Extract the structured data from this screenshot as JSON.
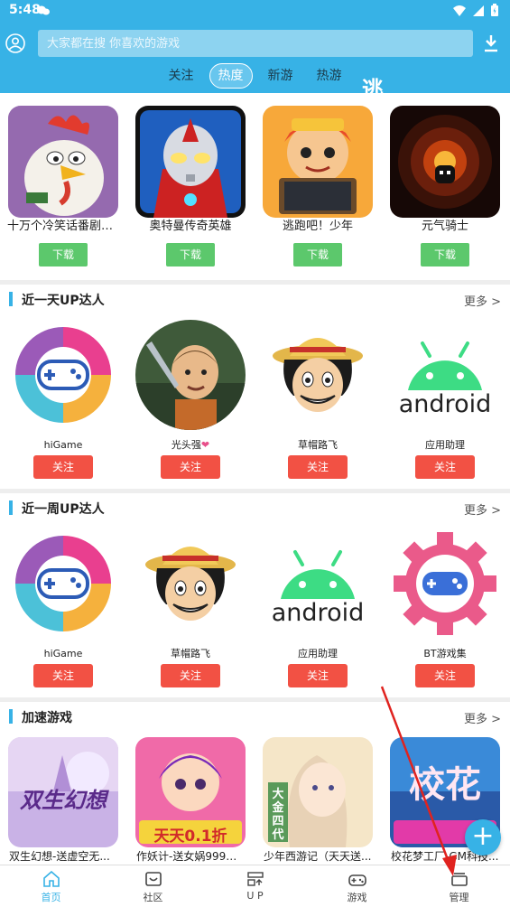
{
  "status_bar": {
    "time": "5:48"
  },
  "search": {
    "placeholder": "大家都在搜 你喜欢的游戏"
  },
  "tabs": [
    {
      "label": "关注"
    },
    {
      "label": "热度"
    },
    {
      "label": "新游"
    },
    {
      "label": "热游"
    }
  ],
  "featured_games": [
    {
      "name": "十万个冷笑话番剧版...",
      "button": "下载"
    },
    {
      "name": "奥特曼传奇英雄",
      "button": "下载"
    },
    {
      "name": "逃跑吧！少年",
      "button": "下载",
      "sign_text": "逃"
    },
    {
      "name": "元气骑士",
      "button": "下载"
    }
  ],
  "section_day": {
    "title": "近一天UP达人",
    "more": "更多 >",
    "users": [
      {
        "name": "hiGame",
        "button": "关注"
      },
      {
        "name": "光头强",
        "button": "关注"
      },
      {
        "name": "草帽路飞",
        "button": "关注"
      },
      {
        "name": "应用助理",
        "button": "关注",
        "logo_text": "android"
      }
    ]
  },
  "section_week": {
    "title": "近一周UP达人",
    "more": "更多 >",
    "users": [
      {
        "name": "hiGame",
        "button": "关注"
      },
      {
        "name": "草帽路飞",
        "button": "关注"
      },
      {
        "name": "应用助理",
        "button": "关注",
        "logo_text": "android"
      },
      {
        "name": "BT游戏集",
        "button": "关注"
      }
    ]
  },
  "section_accel": {
    "title": "加速游戏",
    "more": "更多 >",
    "games": [
      {
        "name": "双生幻想-送虚空无...",
        "cover_text": "双生幻想"
      },
      {
        "name": "作妖计-送女娲999现...",
        "cover_text": "天天0.1折"
      },
      {
        "name": "少年西游记（天天送...",
        "cover_text": "大金四代"
      },
      {
        "name": "校花梦工厂-GM科技...",
        "cover_text": "校花"
      }
    ]
  },
  "fab": {
    "label": "+"
  },
  "bottom_nav": [
    {
      "label": "首页",
      "icon": "home-icon"
    },
    {
      "label": "社区",
      "icon": "community-icon"
    },
    {
      "label": "U P",
      "icon": "up-icon"
    },
    {
      "label": "游戏",
      "icon": "gamepad-icon"
    },
    {
      "label": "管理",
      "icon": "manage-icon"
    }
  ],
  "colors": {
    "accent": "#37b2e6",
    "download": "#5cc86c",
    "follow": "#f25144"
  }
}
